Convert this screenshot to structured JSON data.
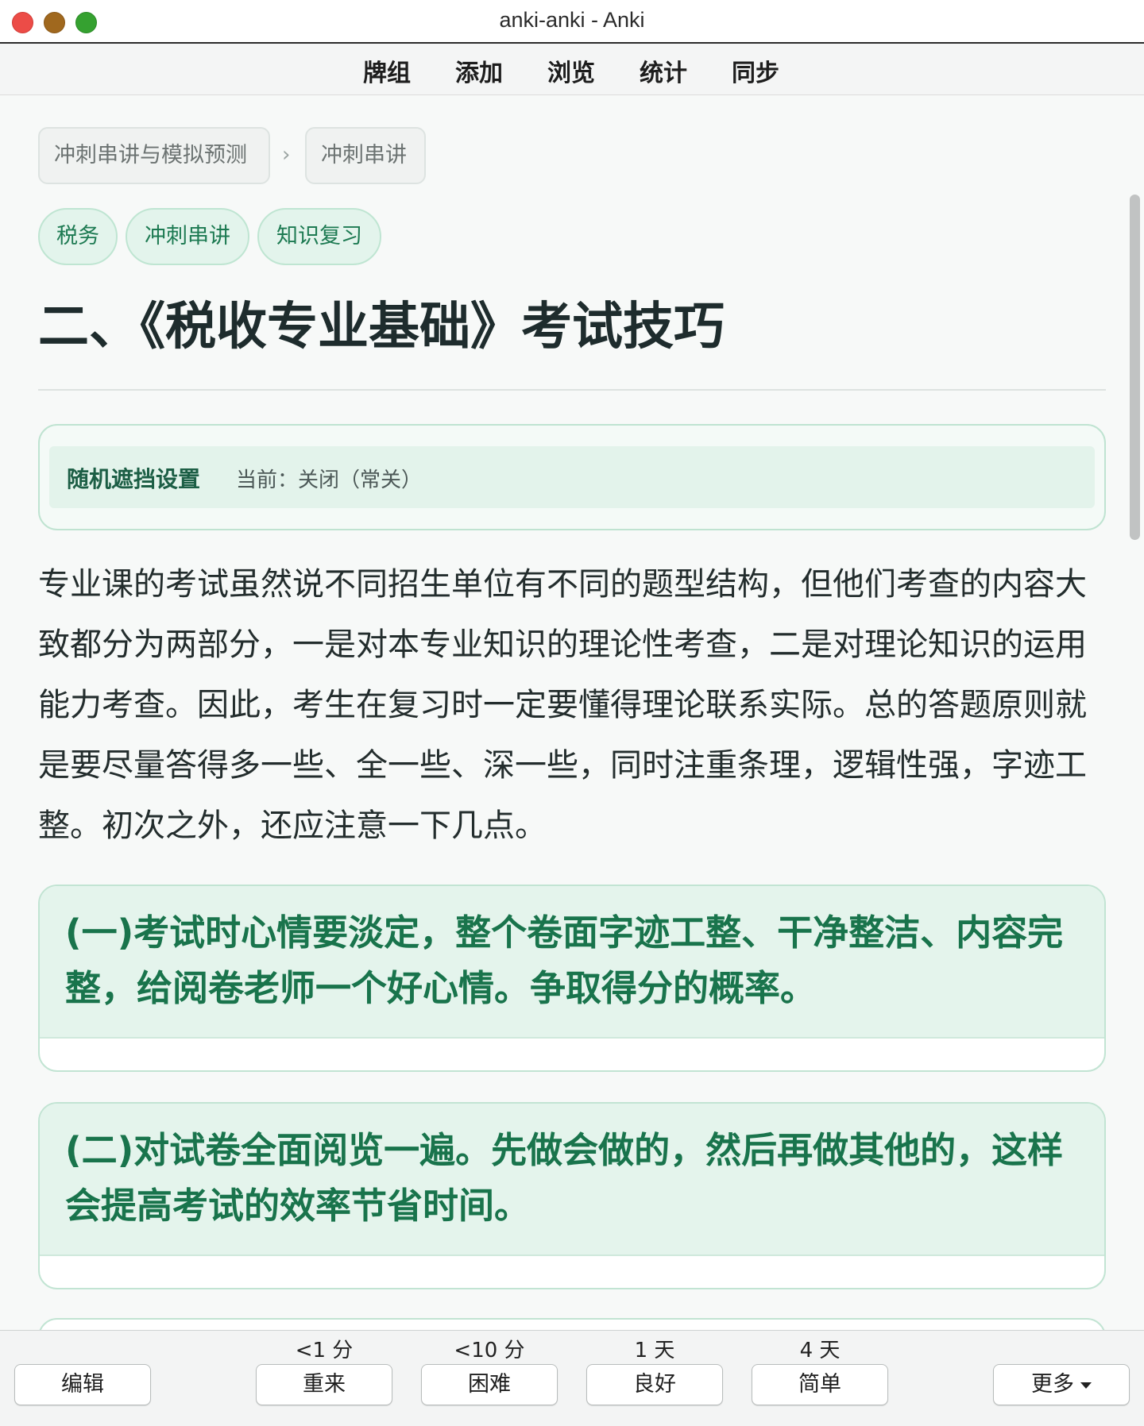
{
  "window": {
    "title": "anki-anki - Anki"
  },
  "menu": {
    "items": [
      "牌组",
      "添加",
      "浏览",
      "统计",
      "同步"
    ]
  },
  "breadcrumb": {
    "items": [
      "冲刺串讲与模拟预测",
      "冲刺串讲"
    ],
    "separator": "›"
  },
  "tags": [
    "税务",
    "冲刺串讲",
    "知识复习"
  ],
  "card": {
    "title": "二、《税收专业基础》考试技巧",
    "mask": {
      "label": "随机遮挡设置",
      "status": "当前：关闭（常关）"
    },
    "intro": "专业课的考试虽然说不同招生单位有不同的题型结构，但他们考查的内容大致都分为两部分，一是对本专业知识的理论性考查，二是对理论知识的运用能力考查。因此，考生在复习时一定要懂得理论联系实际。总的答题原则就是要尽量答得多一些、全一些、深一些，同时注重条理，逻辑性强，字迹工整。初次之外，还应注意一下几点。",
    "sections": [
      {
        "heading": "(一)考试时心情要淡定，整个卷面字迹工整、干净整洁、内容完整，给阅卷老师一个好心情。争取得分的概率。"
      },
      {
        "heading": "(二)对试卷全面阅览一遍。先做会做的，然后再做其他的，这样会提高考试的效率节省时间。"
      }
    ]
  },
  "bottom_bar": {
    "edit_label": "编辑",
    "answers": [
      {
        "interval": "<1 分",
        "label": "重来"
      },
      {
        "interval": "<10 分",
        "label": "困难"
      },
      {
        "interval": "1 天",
        "label": "良好"
      },
      {
        "interval": "4 天",
        "label": "简单"
      }
    ],
    "more_label": "更多"
  },
  "colors": {
    "accent": "#19744c",
    "tag_bg": "#e3f4ec",
    "card_head_bg": "#e4f4ec"
  }
}
